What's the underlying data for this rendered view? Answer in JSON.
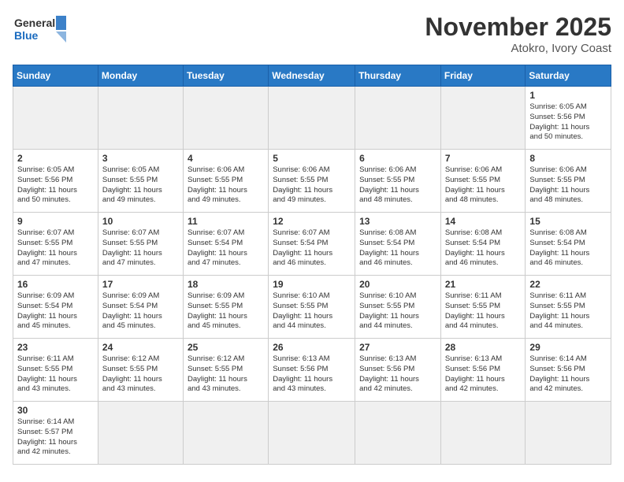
{
  "header": {
    "logo_general": "General",
    "logo_blue": "Blue",
    "month_title": "November 2025",
    "location": "Atokro, Ivory Coast"
  },
  "days_of_week": [
    "Sunday",
    "Monday",
    "Tuesday",
    "Wednesday",
    "Thursday",
    "Friday",
    "Saturday"
  ],
  "weeks": [
    [
      {
        "day": "",
        "info": ""
      },
      {
        "day": "",
        "info": ""
      },
      {
        "day": "",
        "info": ""
      },
      {
        "day": "",
        "info": ""
      },
      {
        "day": "",
        "info": ""
      },
      {
        "day": "",
        "info": ""
      },
      {
        "day": "1",
        "info": "Sunrise: 6:05 AM\nSunset: 5:56 PM\nDaylight: 11 hours\nand 50 minutes."
      }
    ],
    [
      {
        "day": "2",
        "info": "Sunrise: 6:05 AM\nSunset: 5:56 PM\nDaylight: 11 hours\nand 50 minutes."
      },
      {
        "day": "3",
        "info": "Sunrise: 6:05 AM\nSunset: 5:55 PM\nDaylight: 11 hours\nand 49 minutes."
      },
      {
        "day": "4",
        "info": "Sunrise: 6:06 AM\nSunset: 5:55 PM\nDaylight: 11 hours\nand 49 minutes."
      },
      {
        "day": "5",
        "info": "Sunrise: 6:06 AM\nSunset: 5:55 PM\nDaylight: 11 hours\nand 49 minutes."
      },
      {
        "day": "6",
        "info": "Sunrise: 6:06 AM\nSunset: 5:55 PM\nDaylight: 11 hours\nand 48 minutes."
      },
      {
        "day": "7",
        "info": "Sunrise: 6:06 AM\nSunset: 5:55 PM\nDaylight: 11 hours\nand 48 minutes."
      },
      {
        "day": "8",
        "info": "Sunrise: 6:06 AM\nSunset: 5:55 PM\nDaylight: 11 hours\nand 48 minutes."
      }
    ],
    [
      {
        "day": "9",
        "info": "Sunrise: 6:07 AM\nSunset: 5:55 PM\nDaylight: 11 hours\nand 47 minutes."
      },
      {
        "day": "10",
        "info": "Sunrise: 6:07 AM\nSunset: 5:55 PM\nDaylight: 11 hours\nand 47 minutes."
      },
      {
        "day": "11",
        "info": "Sunrise: 6:07 AM\nSunset: 5:54 PM\nDaylight: 11 hours\nand 47 minutes."
      },
      {
        "day": "12",
        "info": "Sunrise: 6:07 AM\nSunset: 5:54 PM\nDaylight: 11 hours\nand 46 minutes."
      },
      {
        "day": "13",
        "info": "Sunrise: 6:08 AM\nSunset: 5:54 PM\nDaylight: 11 hours\nand 46 minutes."
      },
      {
        "day": "14",
        "info": "Sunrise: 6:08 AM\nSunset: 5:54 PM\nDaylight: 11 hours\nand 46 minutes."
      },
      {
        "day": "15",
        "info": "Sunrise: 6:08 AM\nSunset: 5:54 PM\nDaylight: 11 hours\nand 46 minutes."
      }
    ],
    [
      {
        "day": "16",
        "info": "Sunrise: 6:09 AM\nSunset: 5:54 PM\nDaylight: 11 hours\nand 45 minutes."
      },
      {
        "day": "17",
        "info": "Sunrise: 6:09 AM\nSunset: 5:54 PM\nDaylight: 11 hours\nand 45 minutes."
      },
      {
        "day": "18",
        "info": "Sunrise: 6:09 AM\nSunset: 5:55 PM\nDaylight: 11 hours\nand 45 minutes."
      },
      {
        "day": "19",
        "info": "Sunrise: 6:10 AM\nSunset: 5:55 PM\nDaylight: 11 hours\nand 44 minutes."
      },
      {
        "day": "20",
        "info": "Sunrise: 6:10 AM\nSunset: 5:55 PM\nDaylight: 11 hours\nand 44 minutes."
      },
      {
        "day": "21",
        "info": "Sunrise: 6:11 AM\nSunset: 5:55 PM\nDaylight: 11 hours\nand 44 minutes."
      },
      {
        "day": "22",
        "info": "Sunrise: 6:11 AM\nSunset: 5:55 PM\nDaylight: 11 hours\nand 44 minutes."
      }
    ],
    [
      {
        "day": "23",
        "info": "Sunrise: 6:11 AM\nSunset: 5:55 PM\nDaylight: 11 hours\nand 43 minutes."
      },
      {
        "day": "24",
        "info": "Sunrise: 6:12 AM\nSunset: 5:55 PM\nDaylight: 11 hours\nand 43 minutes."
      },
      {
        "day": "25",
        "info": "Sunrise: 6:12 AM\nSunset: 5:55 PM\nDaylight: 11 hours\nand 43 minutes."
      },
      {
        "day": "26",
        "info": "Sunrise: 6:13 AM\nSunset: 5:56 PM\nDaylight: 11 hours\nand 43 minutes."
      },
      {
        "day": "27",
        "info": "Sunrise: 6:13 AM\nSunset: 5:56 PM\nDaylight: 11 hours\nand 42 minutes."
      },
      {
        "day": "28",
        "info": "Sunrise: 6:13 AM\nSunset: 5:56 PM\nDaylight: 11 hours\nand 42 minutes."
      },
      {
        "day": "29",
        "info": "Sunrise: 6:14 AM\nSunset: 5:56 PM\nDaylight: 11 hours\nand 42 minutes."
      }
    ],
    [
      {
        "day": "30",
        "info": "Sunrise: 6:14 AM\nSunset: 5:57 PM\nDaylight: 11 hours\nand 42 minutes."
      },
      {
        "day": "",
        "info": ""
      },
      {
        "day": "",
        "info": ""
      },
      {
        "day": "",
        "info": ""
      },
      {
        "day": "",
        "info": ""
      },
      {
        "day": "",
        "info": ""
      },
      {
        "day": "",
        "info": ""
      }
    ]
  ]
}
